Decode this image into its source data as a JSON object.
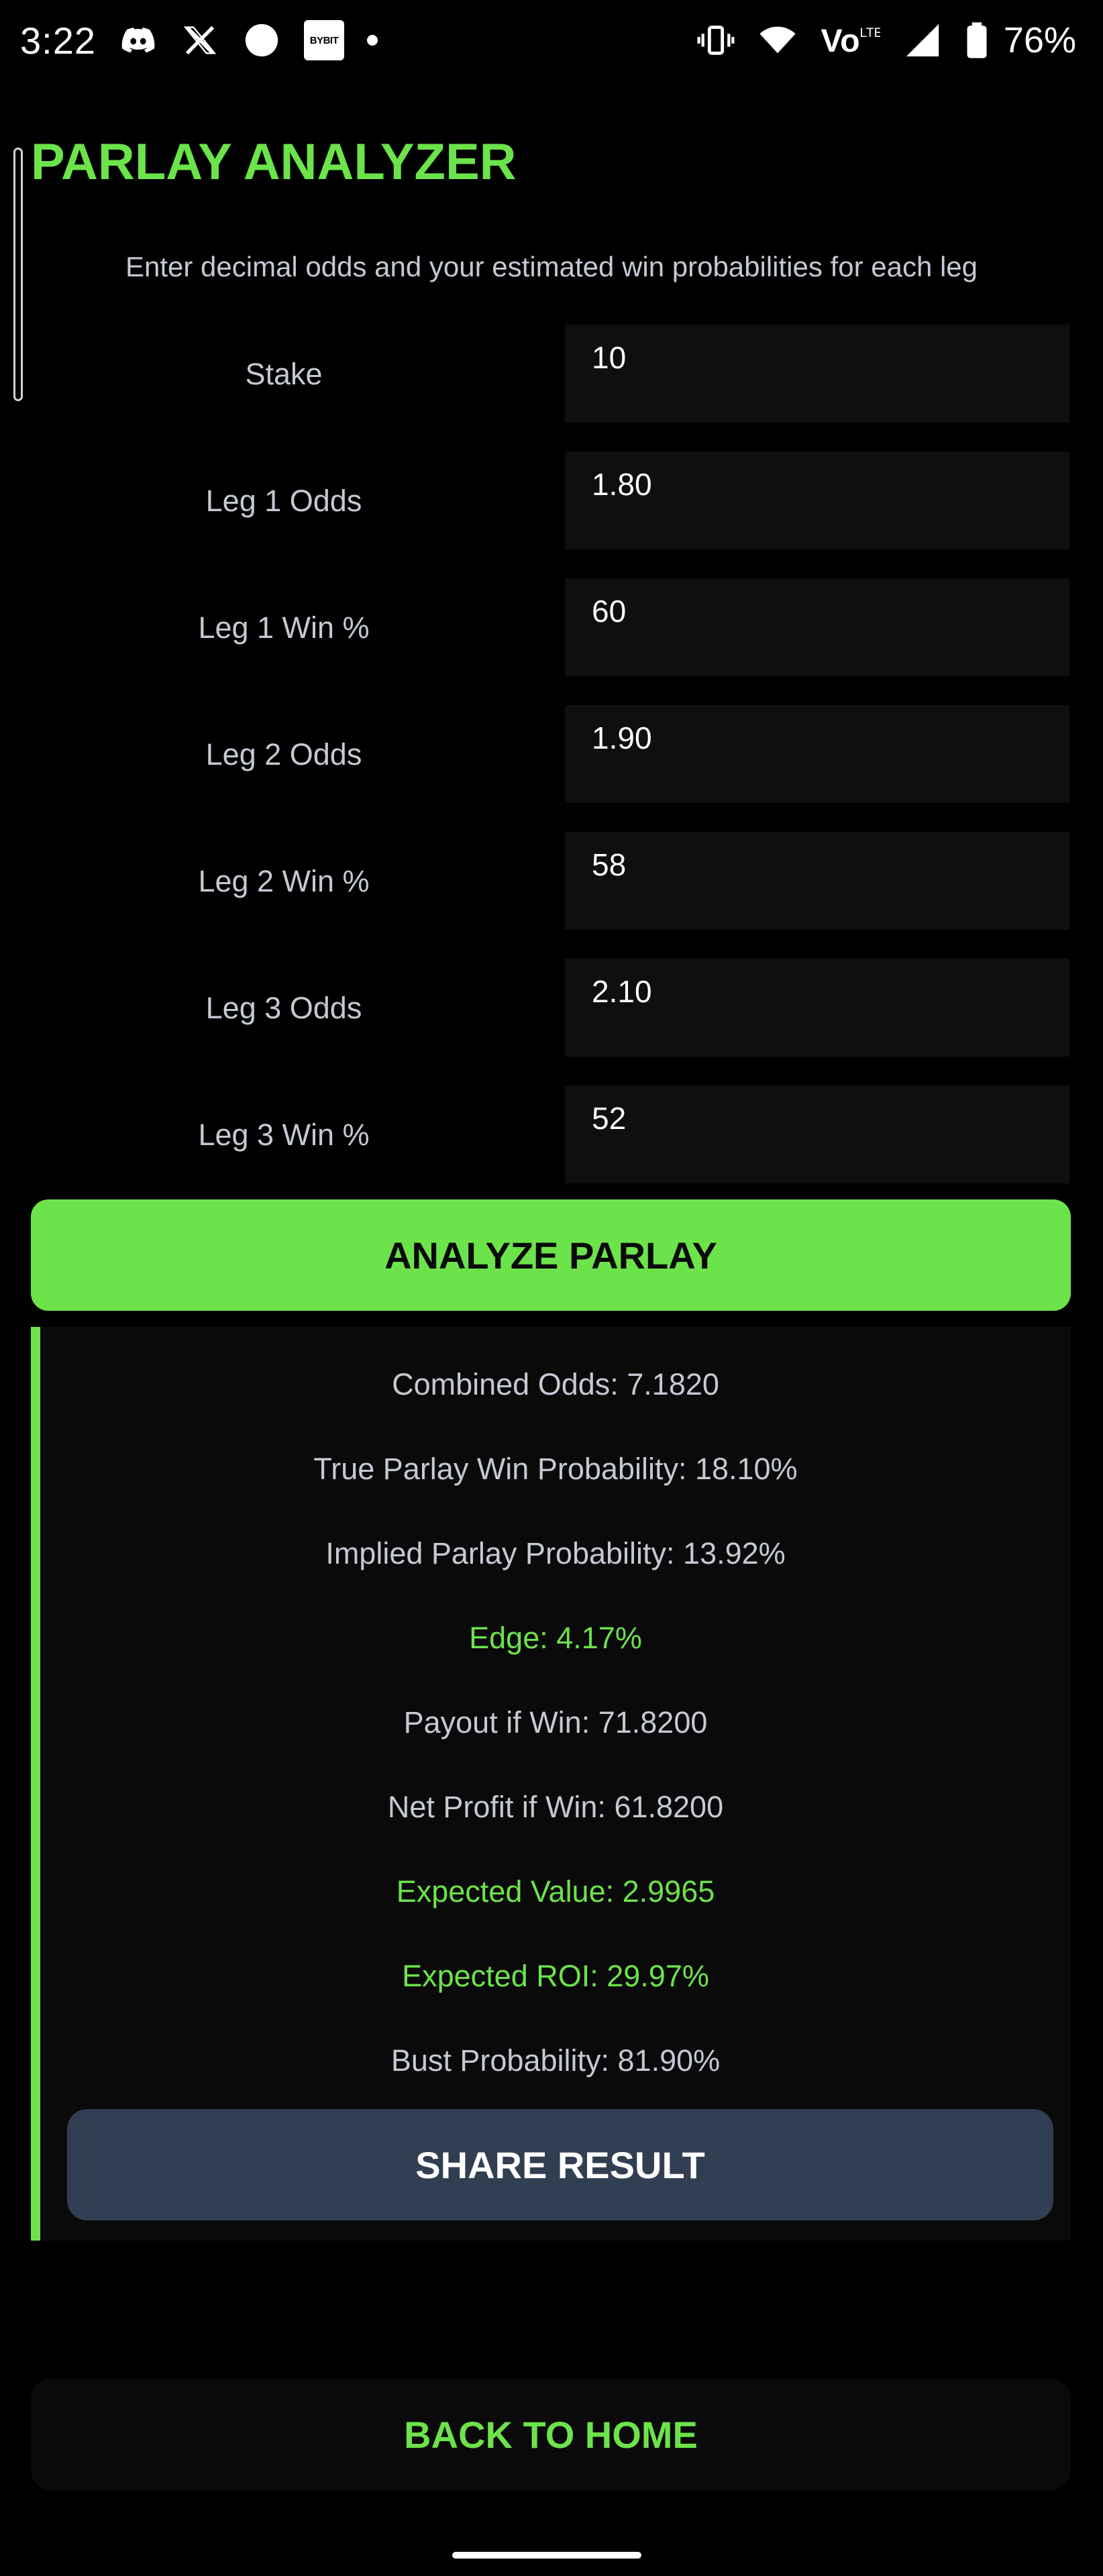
{
  "status_bar": {
    "time": "3:22",
    "battery": "76%",
    "icons": [
      "discord-icon",
      "x-icon",
      "circle-icon",
      "bybit-icon",
      "dot-icon",
      "vibrate-icon",
      "wifi-icon",
      "volte-icon",
      "signal-icon",
      "battery-icon"
    ],
    "bybit_label": "BYBIT"
  },
  "header": {
    "title": "PARLAY ANALYZER",
    "subtitle": "Enter decimal odds and your estimated win probabilities for each leg"
  },
  "form": {
    "stake": {
      "label": "Stake",
      "value": "10"
    },
    "leg1_odds": {
      "label": "Leg 1 Odds",
      "value": "1.80"
    },
    "leg1_win": {
      "label": "Leg 1 Win %",
      "value": "60"
    },
    "leg2_odds": {
      "label": "Leg 2 Odds",
      "value": "1.90"
    },
    "leg2_win": {
      "label": "Leg 2 Win %",
      "value": "58"
    },
    "leg3_odds": {
      "label": "Leg 3 Odds",
      "value": "2.10"
    },
    "leg3_win": {
      "label": "Leg 3 Win %",
      "value": "52"
    }
  },
  "analyze_button": "ANALYZE PARLAY",
  "results": {
    "combined_odds": "Combined Odds: 7.1820",
    "true_probability": "True Parlay Win Probability: 18.10%",
    "implied_probability": "Implied Parlay Probability: 13.92%",
    "edge": "Edge: 4.17%",
    "payout": "Payout if Win: 71.8200",
    "net_profit": "Net Profit if Win: 61.8200",
    "expected_value": "Expected Value: 2.9965",
    "expected_roi": "Expected ROI: 29.97%",
    "bust_probability": "Bust Probability: 81.90%",
    "share_button": "SHARE RESULT"
  },
  "back_button": "BACK TO HOME",
  "colors": {
    "accent_green": "#6ce34a",
    "background": "#000000",
    "input_bg": "#0f0f0f",
    "share_bg": "#323f52"
  }
}
